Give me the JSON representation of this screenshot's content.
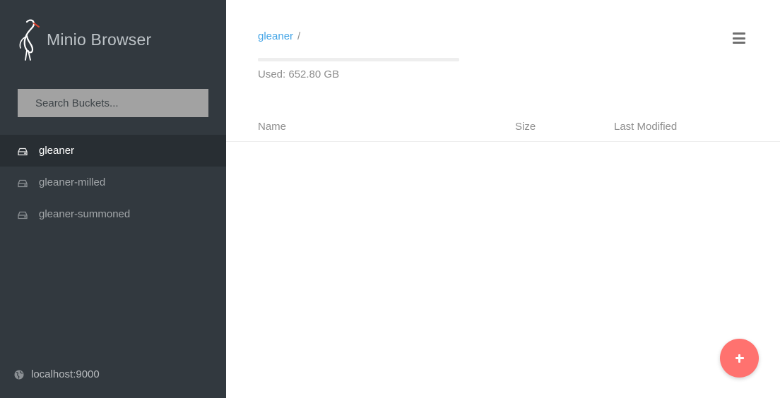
{
  "app": {
    "title": "Minio Browser",
    "logo_icon": "minio-heron-logo"
  },
  "sidebar": {
    "search": {
      "placeholder": "Search Buckets...",
      "value": ""
    },
    "buckets": [
      {
        "label": "gleaner",
        "active": true,
        "icon": "hdd-icon"
      },
      {
        "label": "gleaner-milled",
        "active": false,
        "icon": "hdd-icon"
      },
      {
        "label": "gleaner-summoned",
        "active": false,
        "icon": "hdd-icon"
      }
    ],
    "host": {
      "label": "localhost:9000",
      "icon": "globe-icon"
    }
  },
  "main": {
    "breadcrumb": {
      "bucket": "gleaner",
      "separator": "/"
    },
    "usage": {
      "text": "Used: 652.80 GB"
    },
    "table": {
      "headers": {
        "name": "Name",
        "size": "Size",
        "modified": "Last Modified"
      },
      "rows": []
    },
    "menu_icon": "hamburger-menu-icon",
    "fab_icon": "plus-icon"
  },
  "colors": {
    "sidebar_bg": "#32393f",
    "sidebar_active_bg": "#282e33",
    "link": "#46a6e7",
    "fab": "#ff726f"
  }
}
